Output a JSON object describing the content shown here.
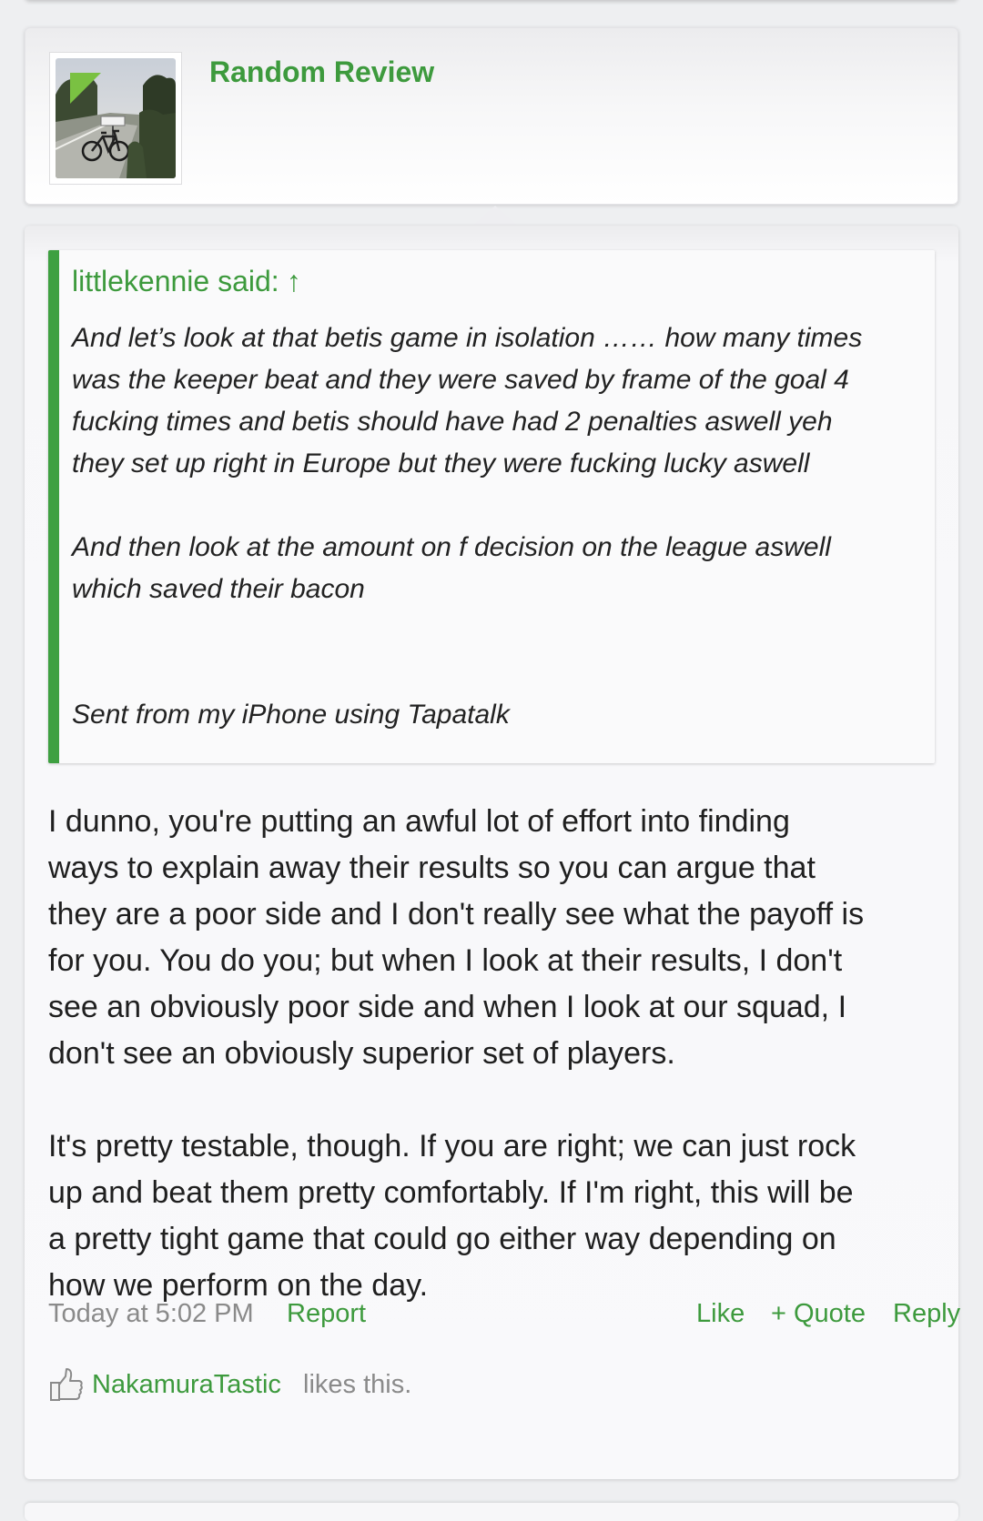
{
  "author": {
    "name": "Random Review",
    "avatar_icon": "bicycle-roadside-photo",
    "online_badge_color": "#7ac142"
  },
  "quote": {
    "author_label": "littlekennie said:",
    "arrow": "↑",
    "lines_para1": [
      "And let’s look at that betis game in isolation …… how many times",
      "was the keeper beat and they were saved by frame of the goal 4",
      "fucking times and betis should have had 2 penalties aswell yeh",
      "they set up right in Europe but they were fucking lucky aswell"
    ],
    "lines_para2": [
      "And then look at the amount on f decision on the league aswell",
      "which saved their bacon"
    ],
    "signature": "Sent from my iPhone using Tapatalk"
  },
  "post": {
    "para1": [
      "I dunno, you're putting an awful lot of effort into finding",
      "ways to explain away their results so you can argue that",
      "they are a poor side and I don't really see what the payoff is",
      "for you. You do you; but when I look at their results, I don't",
      "see an obviously poor side and when I look at our squad, I",
      "don't see an obviously superior set of players."
    ],
    "para2": [
      "It's pretty testable, though. If you are right; we can just rock",
      "up and beat them pretty comfortably. If I'm right, this will be",
      "a pretty tight game that could go either way depending on",
      "how we perform on the day."
    ]
  },
  "meta": {
    "timestamp": "Today at 5:02 PM",
    "report": "Report",
    "like": "Like",
    "quote": "+ Quote",
    "reply": "Reply"
  },
  "likes": {
    "icon": "thumbs-up-icon",
    "user": "NakamuraTastic",
    "tail": "likes this."
  },
  "colors": {
    "accent_green": "#3d9a3d",
    "quote_bar": "#3ea041",
    "muted_text": "#8a8a8a"
  }
}
